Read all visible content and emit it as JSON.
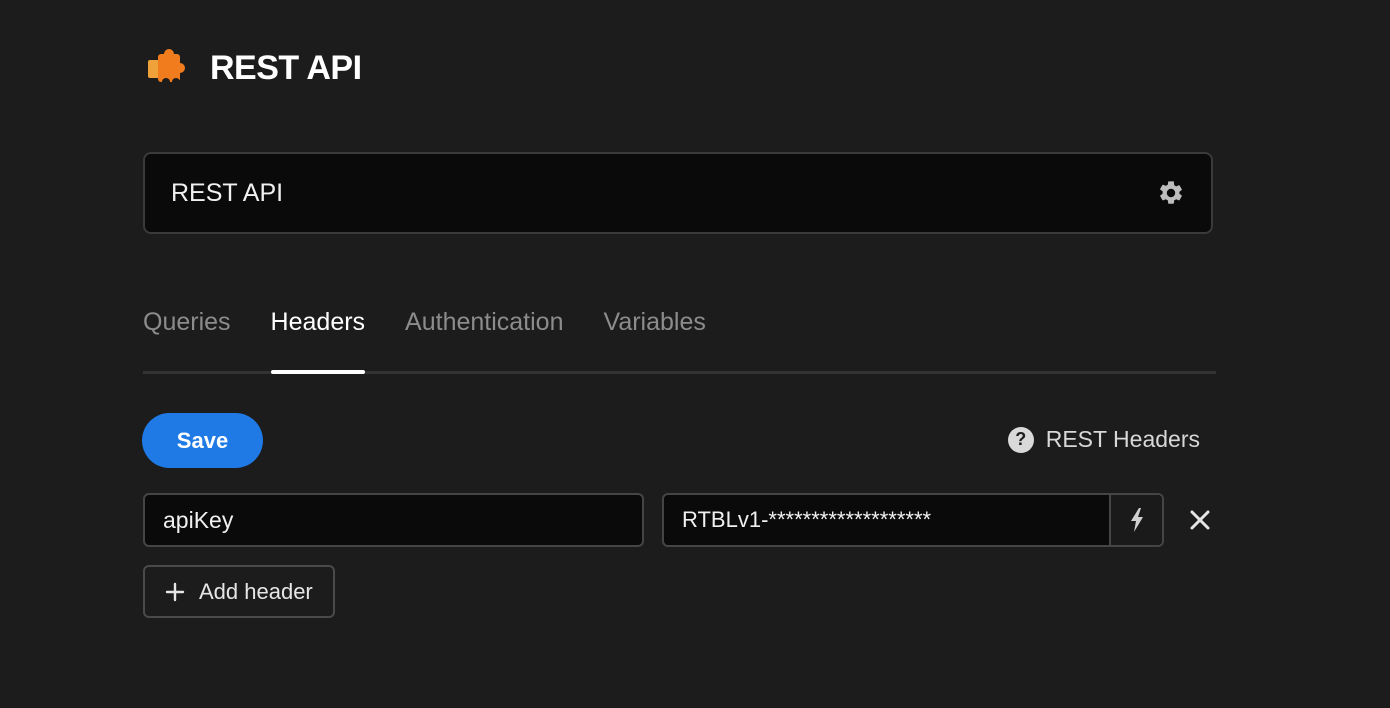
{
  "header": {
    "title": "REST API",
    "icon": "puzzle-piece-icon"
  },
  "name_field": {
    "value": "REST API",
    "settings_icon": "gear-icon"
  },
  "tabs": [
    {
      "label": "Queries",
      "active": false
    },
    {
      "label": "Headers",
      "active": true
    },
    {
      "label": "Authentication",
      "active": false
    },
    {
      "label": "Variables",
      "active": false
    }
  ],
  "toolbar": {
    "save_label": "Save",
    "help_label": "REST Headers",
    "help_icon": "question-circle-icon"
  },
  "headers": [
    {
      "key": "apiKey",
      "value": "RTBLv1-*******************"
    }
  ],
  "add_header_label": "Add header",
  "colors": {
    "background": "#1c1c1c",
    "accent": "#1f7ae6",
    "icon_orange": "#f0901e"
  }
}
